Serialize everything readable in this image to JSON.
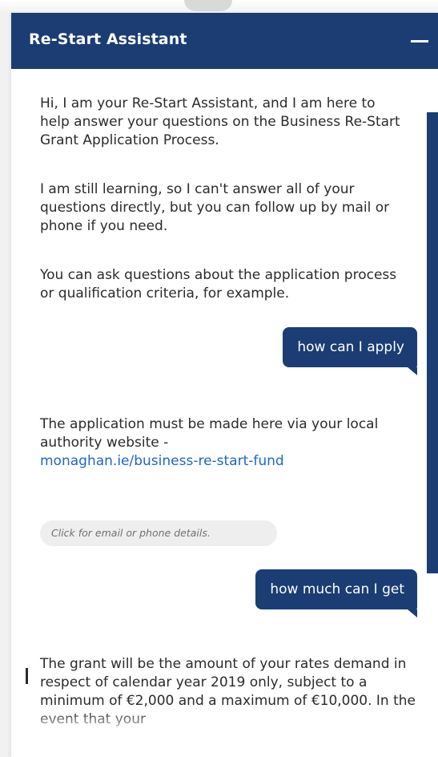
{
  "header": {
    "title": "Re-Start Assistant"
  },
  "messages": {
    "intro": [
      "Hi, I am your Re-Start Assistant, and I am here to help answer your questions on the Business Re-Start Grant Application Process.",
      "I am still learning, so I can't answer all of your questions directly, but you can follow up by mail or phone if you need.",
      "You can ask questions about the application process or qualification criteria, for example."
    ],
    "user_1": "how can I apply",
    "reply_1_text": "The application must be made here via your local authority website -",
    "reply_1_link": "monaghan.ie/business-re-start-fund",
    "contact_chip": "Click for email or phone details.",
    "user_2": "how much can I get",
    "reply_2_text": "The grant will be the amount of your rates demand in respect of calendar year 2019 only, subject to a minimum of €2,000 and a maximum of €10,000. In the event that your"
  },
  "colors": {
    "brand_navy": "#1b3d73",
    "link_blue": "#1f66c4"
  }
}
